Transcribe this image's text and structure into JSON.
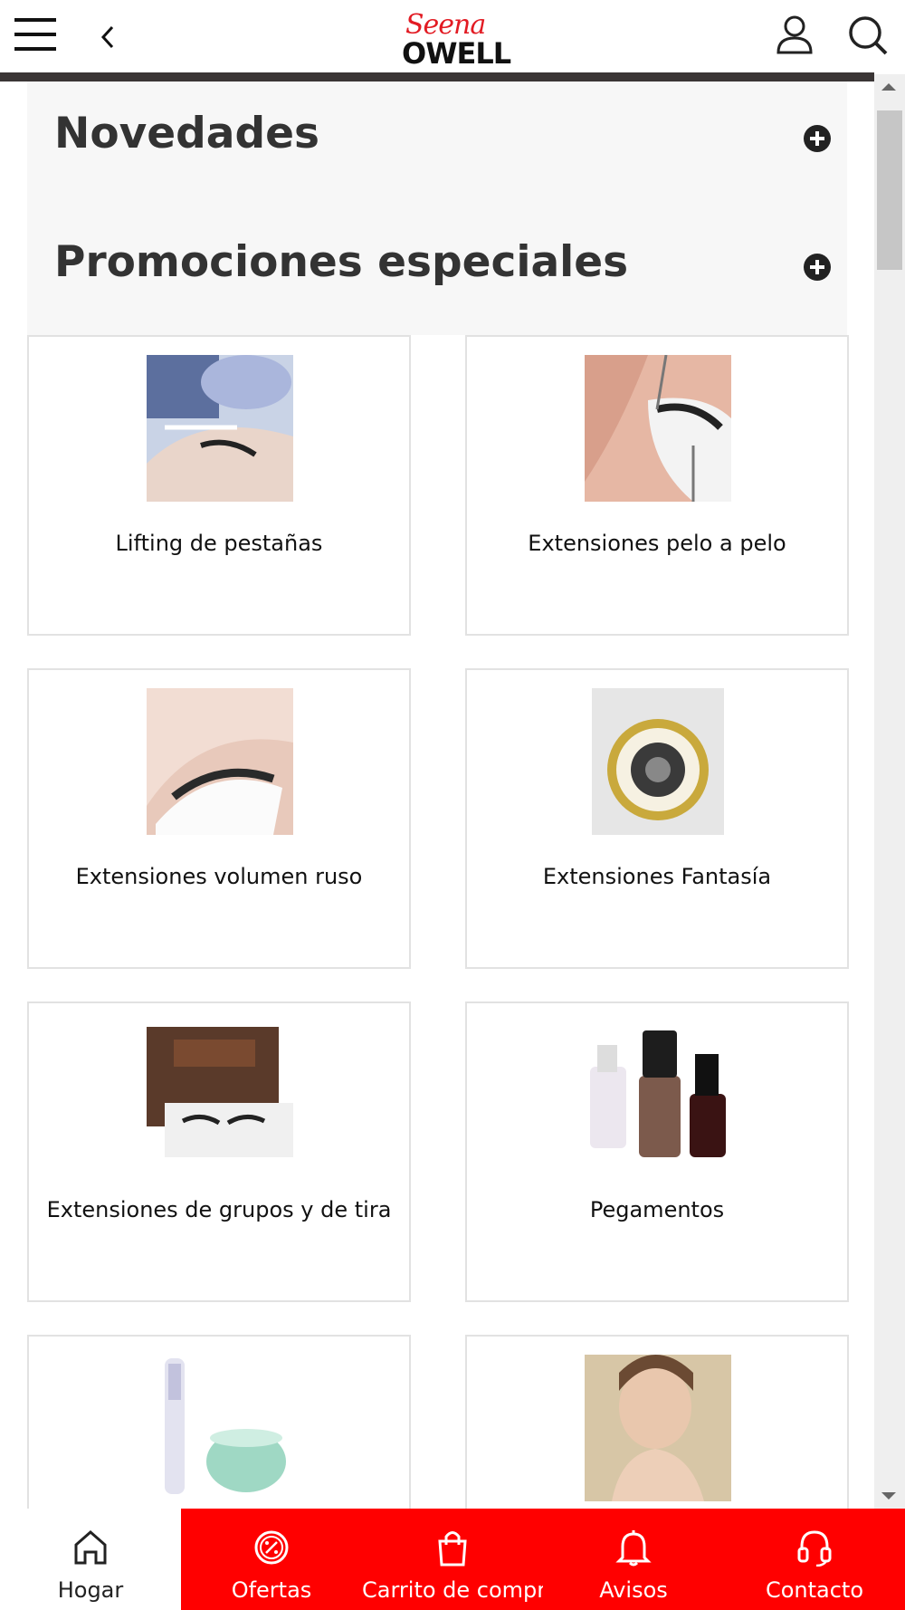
{
  "header": {
    "logo_script": "Seena",
    "logo_main": "OWELL",
    "menu_icon": "hamburger-menu-icon",
    "back_icon": "chevron-left-icon",
    "account_icon": "user-icon",
    "search_icon": "search-icon"
  },
  "sections": [
    {
      "title": "Novedades",
      "icon": "plus-circle-icon"
    },
    {
      "title": "Promociones especiales",
      "icon": "plus-circle-icon"
    }
  ],
  "categories": [
    {
      "label": "Lifting de pestañas"
    },
    {
      "label": "Extensiones pelo a pelo"
    },
    {
      "label": "Extensiones volumen ruso"
    },
    {
      "label": "Extensiones Fantasía"
    },
    {
      "label": "Extensiones de grupos y de tira"
    },
    {
      "label": "Pegamentos"
    },
    {
      "label": ""
    },
    {
      "label": ""
    }
  ],
  "bottom_nav": [
    {
      "label": "Hogar",
      "icon": "home-icon"
    },
    {
      "label": "Ofertas",
      "icon": "discount-badge-icon"
    },
    {
      "label": "Carrito de compra",
      "icon": "shopping-bag-icon"
    },
    {
      "label": "Avisos",
      "icon": "bell-icon"
    },
    {
      "label": "Contacto",
      "icon": "headset-icon"
    }
  ],
  "colors": {
    "accent": "#ff0000",
    "logo_red": "#e21b23",
    "text": "#333333"
  }
}
